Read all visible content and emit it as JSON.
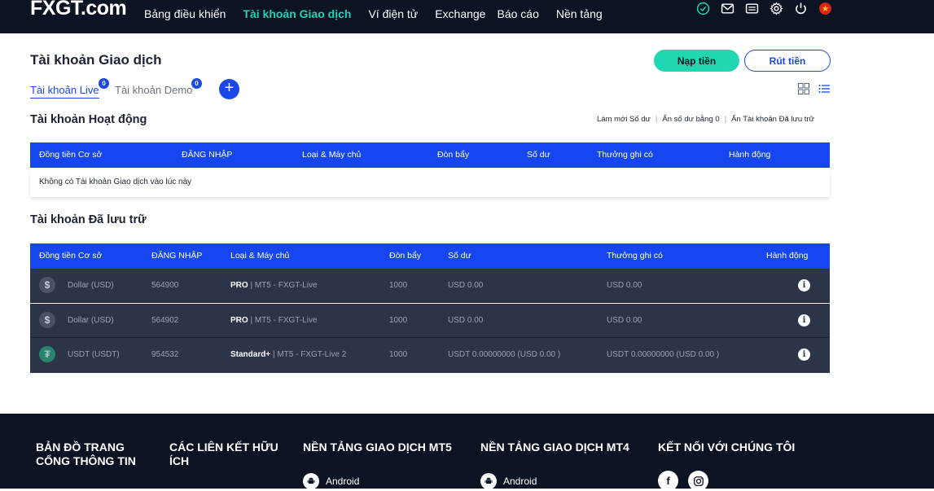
{
  "brand": {
    "logo_text_1": "FX",
    "logo_text_2": "GT",
    "logo_text_3": ".com"
  },
  "nav": {
    "items": [
      {
        "label": "Bảng điều khiển"
      },
      {
        "label": "Tài khoản Giao dịch",
        "active": true
      },
      {
        "label": "Ví điện tử"
      },
      {
        "label": "Exchange"
      },
      {
        "label": "Báo cáo"
      },
      {
        "label": "Nền tảng"
      }
    ],
    "icons": [
      "check-circle-icon",
      "mail-icon",
      "ticket-icon",
      "gear-icon",
      "power-icon",
      "vietnam-flag-icon"
    ]
  },
  "page": {
    "title": "Tài khoản Giao dịch",
    "deposit_label": "Nạp tiền",
    "withdraw_label": "Rút tiền"
  },
  "tabs": {
    "live_label": "Tài khoản Live",
    "live_count": "0",
    "demo_label": "Tài khoản Demo",
    "demo_count": "0",
    "add_symbol": "+"
  },
  "active_section": {
    "title": "Tài khoản Hoạt động",
    "tools": [
      "Làm mới Số dư",
      "Ẩn số dư bằng 0",
      "Ẩn Tài khoản Đã lưu trữ"
    ],
    "headers": [
      "Đồng tiền Cơ sở",
      "ĐĂNG NHẬP",
      "Loại & Máy chủ",
      "Đòn bẩy",
      "Số dư",
      "Thưởng ghi có",
      "Hành động"
    ],
    "empty_message": "Không có Tài khoản Giao dịch vào lúc này"
  },
  "archived_section": {
    "title": "Tài khoản Đã lưu trữ",
    "headers": [
      "Đồng tiền Cơ sở",
      "ĐĂNG NHẬP",
      "Loại & Máy chủ",
      "Đòn bẩy",
      "Số dư",
      "Thưởng ghi có",
      "Hành động"
    ],
    "rows": [
      {
        "coin_symbol": "$",
        "currency": "Dollar (USD)",
        "login": "564900",
        "type": "PRO",
        "server": " | MT5 - FXGT-Live",
        "leverage": "1000",
        "balance": "USD 0.00",
        "bonus": "USD 0.00"
      },
      {
        "coin_symbol": "$",
        "currency": "Dollar (USD)",
        "login": "564902",
        "type": "PRO",
        "server": " | MT5 - FXGT-Live",
        "leverage": "1000",
        "balance": "USD 0.00",
        "bonus": "USD 0.00"
      },
      {
        "coin_symbol": "₮",
        "currency": "USDT (USDT)",
        "login": "954532",
        "type": "Standard+",
        "server": " | MT5 - FXGT-Live 2",
        "leverage": "1000",
        "balance": "USDT 0.00000000 (USD 0.00 )",
        "bonus": "USDT 0.00000000 (USD 0.00 )"
      }
    ]
  },
  "footer": {
    "columns": [
      "BẢN ĐỒ TRANG CỔNG THÔNG TIN",
      "CÁC LIÊN KẾT HỮU ÍCH",
      "NỀN TẢNG GIAO DỊCH MT5",
      "NỀN TẢNG GIAO DỊCH MT4",
      "KẾT NỐI VỚI CHÚNG TÔI"
    ],
    "mt5_android": "Android",
    "mt4_android": "Android",
    "social": [
      "facebook-icon",
      "instagram-icon"
    ]
  },
  "colors": {
    "nav_bg": "#0c1323",
    "accent": "#20d6b3",
    "primary": "#1546f0",
    "row_bg": "#2c3449"
  }
}
